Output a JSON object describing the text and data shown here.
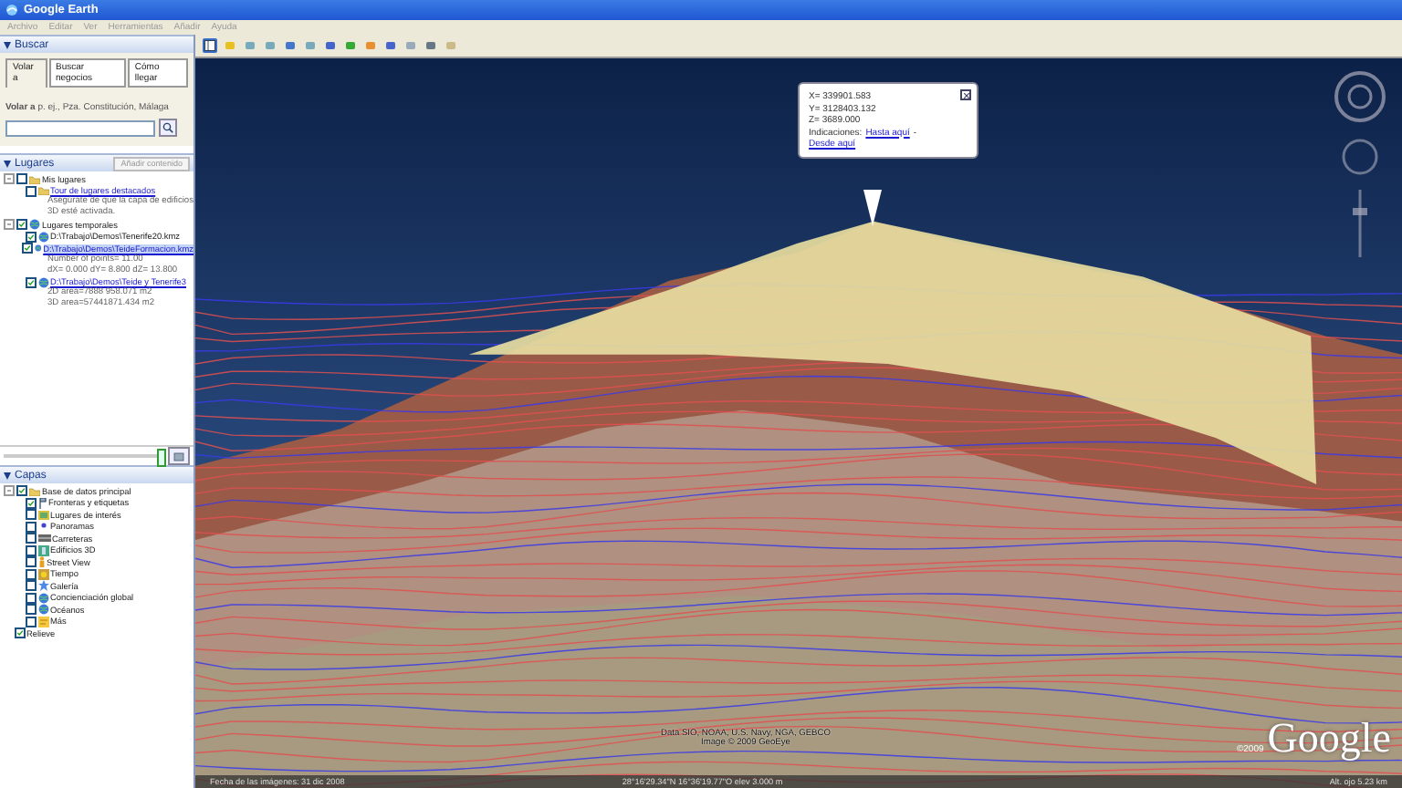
{
  "window": {
    "title": "Google Earth"
  },
  "menu": [
    "Archivo",
    "Editar",
    "Ver",
    "Herramientas",
    "Añadir",
    "Ayuda"
  ],
  "search": {
    "title": "Buscar",
    "expanded": true,
    "tabs": [
      {
        "label": "Volar a",
        "selected": true
      },
      {
        "label": "Buscar negocios",
        "selected": false
      },
      {
        "label": "Cómo llegar",
        "selected": false
      }
    ],
    "hint": "**Volar a** p. ej., Pza. Constitución, Málaga"
  },
  "places": {
    "title": "Lugares",
    "expanded": true,
    "button": "Añadir contenido",
    "items": [
      {
        "label": "Mis lugares",
        "kind": "folder",
        "checked": false,
        "expanded": true,
        "link": false,
        "selected": false,
        "children": [
          {
            "label": "Tour de lugares destacados",
            "kind": "folder",
            "checked": false,
            "link": true,
            "selected": false,
            "description": [
              "Asegúrate de que la capa de edificios",
              "3D esté activada."
            ]
          }
        ]
      },
      {
        "label": "Lugares temporales",
        "kind": "globe",
        "checked": true,
        "expanded": true,
        "link": false,
        "selected": false,
        "children": [
          {
            "label": "D:\\Trabajo\\Demos\\Tenerife20.kmz",
            "kind": "globe",
            "checked": true,
            "link": false,
            "selected": false
          },
          {
            "label": "D:\\Trabajo\\Demos\\TeideFormacion.kmz",
            "kind": "globe",
            "checked": true,
            "link": true,
            "selected": true,
            "description": [
              "Number of points= 11.00",
              "dX= 0.000 dY= 8.800 dZ= 13.800"
            ]
          },
          {
            "label": "D:\\Trabajo\\Demos\\Teide y Tenerife3",
            "kind": "globe",
            "checked": true,
            "link": true,
            "selected": false,
            "description": [
              "2D area=7888 958.071 m2",
              "3D area=57441871.434 m2"
            ]
          }
        ]
      }
    ]
  },
  "layers": {
    "title": "Capas",
    "expanded": true,
    "items": [
      {
        "label": "Base de datos principal",
        "kind": "folder",
        "checked": true,
        "expanded": true,
        "children": [
          {
            "label": "Fronteras y etiquetas",
            "kind": "flag",
            "checked": true
          },
          {
            "label": "Lugares de interés",
            "kind": "poi",
            "checked": false
          },
          {
            "label": "Panoramas",
            "kind": "pin",
            "checked": false
          },
          {
            "label": "Carreteras",
            "kind": "road",
            "checked": false
          },
          {
            "label": "Edificios 3D",
            "kind": "building",
            "checked": false
          },
          {
            "label": "Street View",
            "kind": "person",
            "checked": false
          },
          {
            "label": "Tiempo",
            "kind": "sun",
            "checked": false
          },
          {
            "label": "Galería",
            "kind": "star",
            "checked": false
          },
          {
            "label": "Concienciación global",
            "kind": "globe",
            "checked": false
          },
          {
            "label": "Océanos",
            "kind": "globe",
            "checked": false
          },
          {
            "label": "Más",
            "kind": "note",
            "checked": false
          }
        ]
      },
      {
        "label": "Relieve",
        "kind": "none",
        "checked": true
      }
    ]
  },
  "popup": {
    "lines": [
      "X= 339901.583",
      "Y= 3128403.132",
      "Z= 3689.000"
    ],
    "directions_label": "Indicaciones:",
    "to_here": "Hasta aquí",
    "separator": "-",
    "from_here": "Desde aquí"
  },
  "attribution": [
    "Data SIO, NOAA, U.S. Navy, NGA, GEBCO",
    "Image © 2009 GeoEye"
  ],
  "logo": {
    "year": "©2009",
    "name": "Google"
  },
  "status_bar": {
    "imagery_date": "Fecha de las imágenes: 31 dic 2008",
    "coordinates": "28°16'29.34\"N  16°36'19.77\"O  elev 3.000 m",
    "eye_altitude": "Alt. ojo 5.23 km"
  }
}
